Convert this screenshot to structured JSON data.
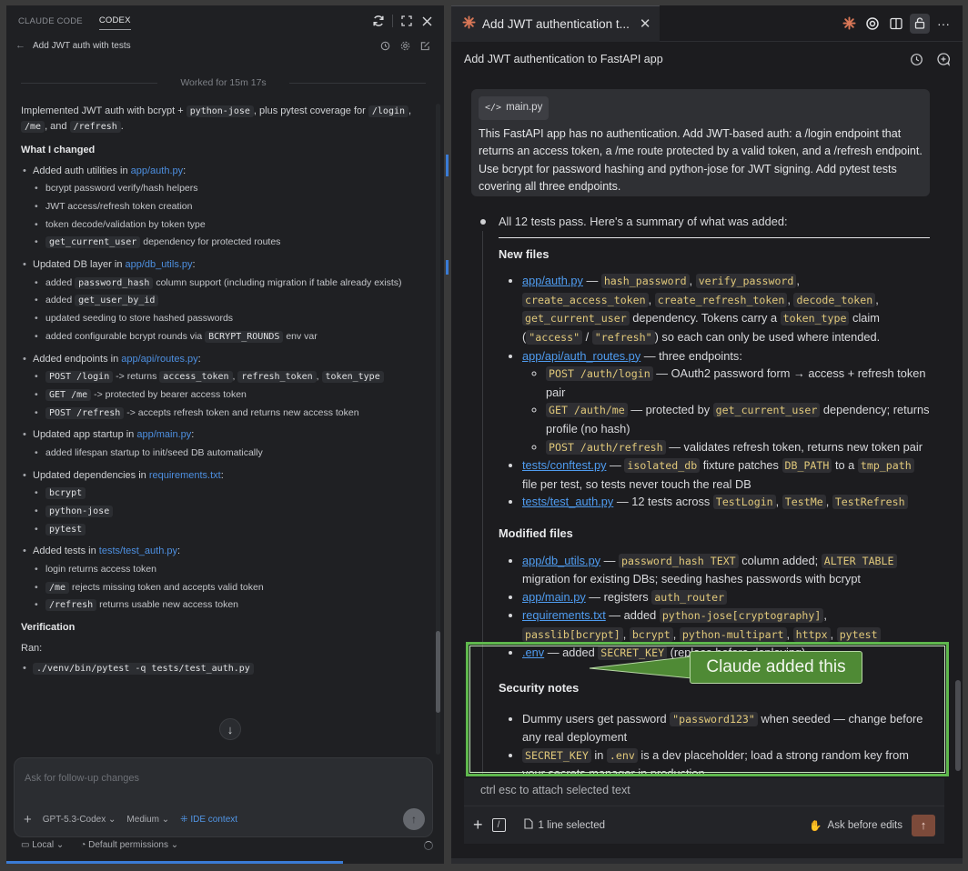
{
  "left": {
    "tabs": [
      "CLAUDE CODE",
      "CODEX"
    ],
    "active_tab": "CODEX",
    "thread_title": "Add JWT auth with tests",
    "worked": "Worked for 15m 17s",
    "summary": {
      "pre": "Implemented JWT auth with bcrypt + ",
      "code1": "python-jose",
      "mid": ", plus pytest coverage for",
      "code2": "/login",
      "sep1": ", ",
      "code3": "/me",
      "sep2": ", and ",
      "code4": "/refresh",
      "end": "."
    },
    "what_changed_heading": "What I changed",
    "sections": [
      {
        "pre": "Added auth utilities in ",
        "link": "app/auth.py",
        "post": ":",
        "items": [
          {
            "text": "bcrypt password verify/hash helpers"
          },
          {
            "text": "JWT access/refresh token creation"
          },
          {
            "text": "token decode/validation by token type"
          },
          {
            "code": "get_current_user",
            "text": " dependency for protected routes"
          }
        ]
      },
      {
        "pre": "Updated DB layer in ",
        "link": "app/db_utils.py",
        "post": ":",
        "items": [
          {
            "pre": "added ",
            "code": "password_hash",
            "text": " column support (including migration if table already exists)"
          },
          {
            "pre": "added ",
            "code": "get_user_by_id",
            "text": ""
          },
          {
            "text": "updated seeding to store hashed passwords"
          },
          {
            "pre": "added configurable bcrypt rounds via ",
            "code": "BCRYPT_ROUNDS",
            "text": " env var"
          }
        ]
      },
      {
        "pre": "Added endpoints in ",
        "link": "app/api/routes.py",
        "post": ":",
        "items": [
          {
            "code": "POST /login",
            "text": " -> returns ",
            "codes": [
              "access_token",
              "refresh_token",
              "token_type"
            ]
          },
          {
            "code": "GET /me",
            "text": " -> protected by bearer access token"
          },
          {
            "code": "POST /refresh",
            "text": " -> accepts refresh token and returns new access token"
          }
        ]
      },
      {
        "pre": "Updated app startup in ",
        "link": "app/main.py",
        "post": ":",
        "items": [
          {
            "text": "added lifespan startup to init/seed DB automatically"
          }
        ]
      },
      {
        "pre": "Updated dependencies in ",
        "link": "requirements.txt",
        "post": ":",
        "items": [
          {
            "code": "bcrypt",
            "text": ""
          },
          {
            "code": "python-jose",
            "text": ""
          },
          {
            "code": "pytest",
            "text": ""
          }
        ]
      },
      {
        "pre": "Added tests in ",
        "link": "tests/test_auth.py",
        "post": ":",
        "items": [
          {
            "text": "login returns access token"
          },
          {
            "code": "/me",
            "text": " rejects missing token and accepts valid token"
          },
          {
            "code": "/refresh",
            "text": " returns usable new access token"
          }
        ]
      }
    ],
    "verification_heading": "Verification",
    "ran_label": "Ran:",
    "ran_cmd": "./venv/bin/pytest -q tests/test_auth.py",
    "composer_placeholder": "Ask for follow-up changes",
    "model": "GPT-5.3-Codex",
    "effort": "Medium",
    "ide_context": "IDE context",
    "footer_env": "Local",
    "footer_perm": "Default permissions"
  },
  "right": {
    "tab_title": "Add JWT authentication t...",
    "conversation_title": "Add JWT authentication to FastAPI app",
    "file_chip": "main.py",
    "user_message": "This FastAPI app has no authentication. Add JWT-based auth: a /login endpoint that returns an access token, a /me route protected by a valid token, and a /refresh endpoint. Use bcrypt for password hashing and python-jose for JWT signing. Add pytest tests covering all three endpoints.",
    "intro": "All 12 tests pass. Here's a summary of what was added:",
    "new_files_heading": "New files",
    "new_files": {
      "auth": {
        "link": "app/auth.py",
        "dash": " — ",
        "codes": [
          "hash_password",
          "verify_password",
          "create_access_token",
          "create_refresh_token",
          "decode_token",
          "get_current_user"
        ],
        "t1": " dependency. Tokens carry a ",
        "code_tt": "token_type",
        "t2": " claim (",
        "code_a": "\"access\"",
        "slash": " / ",
        "code_r": "\"refresh\"",
        "t3": ") so each can only be used where intended."
      },
      "routes": {
        "link": "app/api/auth_routes.py",
        "text": " — three endpoints:"
      },
      "endpoints": [
        {
          "code": "POST /auth/login",
          "text": " — OAuth2 password form → access + refresh token pair"
        },
        {
          "code": "GET /auth/me",
          "text": " — protected by ",
          "code2": "get_current_user",
          "text2": " dependency; returns profile (no hash)"
        },
        {
          "code": "POST /auth/refresh",
          "text": " — validates refresh token, returns new token pair"
        }
      ],
      "conftest": {
        "link": "tests/conftest.py",
        "t1": " — ",
        "code1": "isolated_db",
        "t2": " fixture patches ",
        "code2": "DB_PATH",
        "t3": " to a ",
        "code3": "tmp_path",
        "t4": " file per test, so tests never touch the real DB"
      },
      "test_auth": {
        "link": "tests/test_auth.py",
        "t1": " — 12 tests across ",
        "code1": "TestLogin",
        "code2": "TestMe",
        "code3": "TestRefresh"
      }
    },
    "modified_heading": "Modified files",
    "modified": {
      "db_utils": {
        "link": "app/db_utils.py",
        "t1": " — ",
        "code1": "password_hash TEXT",
        "t2": " column added; ",
        "code2": "ALTER TABLE",
        "t3": " migration for existing DBs; seeding hashes passwords with bcrypt"
      },
      "main": {
        "link": "app/main.py",
        "t1": " — registers ",
        "code1": "auth_router"
      },
      "requirements": {
        "link": "requirements.txt",
        "t1": " — added ",
        "codes": [
          "python-jose[cryptography]",
          "passlib[bcrypt]",
          "bcrypt",
          "python-multipart",
          "httpx",
          "pytest"
        ]
      },
      "env": {
        "link": ".env",
        "t1": " — added ",
        "code1": "SECRET_KEY",
        "t2": " (replace before deploying)"
      }
    },
    "security_heading": "Security notes",
    "security": [
      {
        "t1": "Dummy users get password ",
        "code1": "\"password123\"",
        "t2": " when seeded — change before any real deployment"
      },
      {
        "code1": "SECRET_KEY",
        "t1": " in ",
        "code2": ".env",
        "t2": " is a dev placeholder; load a strong random key from your secrets manager in production"
      }
    ],
    "attach_hint": "ctrl esc to attach selected text",
    "selection": "1 line selected",
    "ask_mode": "Ask before edits"
  },
  "annotation": {
    "callout_text": "Claude added this",
    "highlight_color": "#5fb84d"
  }
}
